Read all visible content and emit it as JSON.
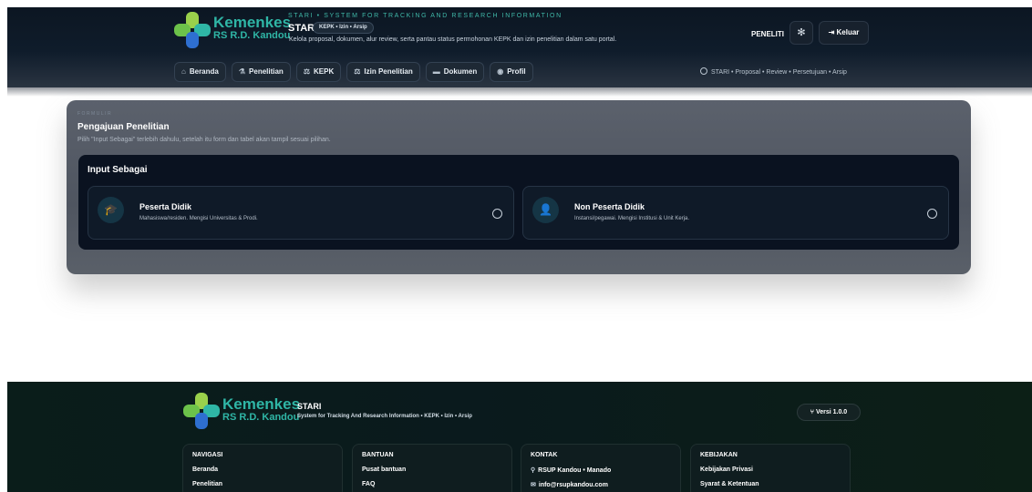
{
  "brand": {
    "name": "Kemenkes",
    "sub": "RS R.D. Kandou",
    "colors": {
      "green": "#6cc24a",
      "blue": "#2e6fd0",
      "teal": "#2fb6a6",
      "lime": "#9ad14b"
    }
  },
  "header": {
    "eyebrow": "STARI • SYSTEM FOR TRACKING AND RESEARCH INFORMATION",
    "app_title": "STARI",
    "chip": "KEPK • Izin • Arsip",
    "description": "Kelola proposal, dokumen, alur review, serta pantau status permohonan KEPK dan izin penelitian dalam satu portal.",
    "role": "PENELITI",
    "settings_icon": "gear-icon",
    "logout_label": "Keluar"
  },
  "nav": {
    "items": [
      {
        "label": "Beranda",
        "icon": "⌂"
      },
      {
        "label": "Penelitian",
        "icon": "⚗"
      },
      {
        "label": "KEPK",
        "icon": "⚖"
      },
      {
        "label": "Izin Penelitian",
        "icon": "⚖"
      },
      {
        "label": "Dokumen",
        "icon": "▬"
      },
      {
        "label": "Profil",
        "icon": "◉"
      }
    ],
    "trail": "STARI • Proposal • Review • Persetujuan • Arsip"
  },
  "main": {
    "eyebrow": "FORMULIR",
    "title": "Pengajuan Penelitian",
    "description": "Pilih \"Input Sebagai\" terlebih dahulu, setelah itu form dan tabel akan tampil sesuai pilihan.",
    "input_as": {
      "title": "Input Sebagai",
      "options": [
        {
          "title": "Peserta Didik",
          "description": "Mahasiswa/residen. Mengisi Universitas & Prodi.",
          "icon": "graduation-cap-icon",
          "selected": false
        },
        {
          "title": "Non Peserta Didik",
          "description": "Instansi/pegawai. Mengisi Institusi & Unit Kerja.",
          "icon": "user-icon",
          "selected": false
        }
      ]
    }
  },
  "footer": {
    "app_title": "STARI",
    "subtitle": "System for Tracking And Research Information • KEPK • Izin • Arsip",
    "version": "Versi 1.0.0",
    "columns": [
      {
        "heading": "NAVIGASI",
        "items": [
          "Beranda",
          "Penelitian"
        ]
      },
      {
        "heading": "BANTUAN",
        "items": [
          "Pusat bantuan",
          "FAQ"
        ]
      },
      {
        "heading": "KONTAK",
        "items": [
          "RSUP Kandou • Manado",
          "info@rsupkandou.com"
        ]
      },
      {
        "heading": "KEBIJAKAN",
        "items": [
          "Kebijakan Privasi",
          "Syarat & Ketentuan"
        ]
      }
    ]
  }
}
